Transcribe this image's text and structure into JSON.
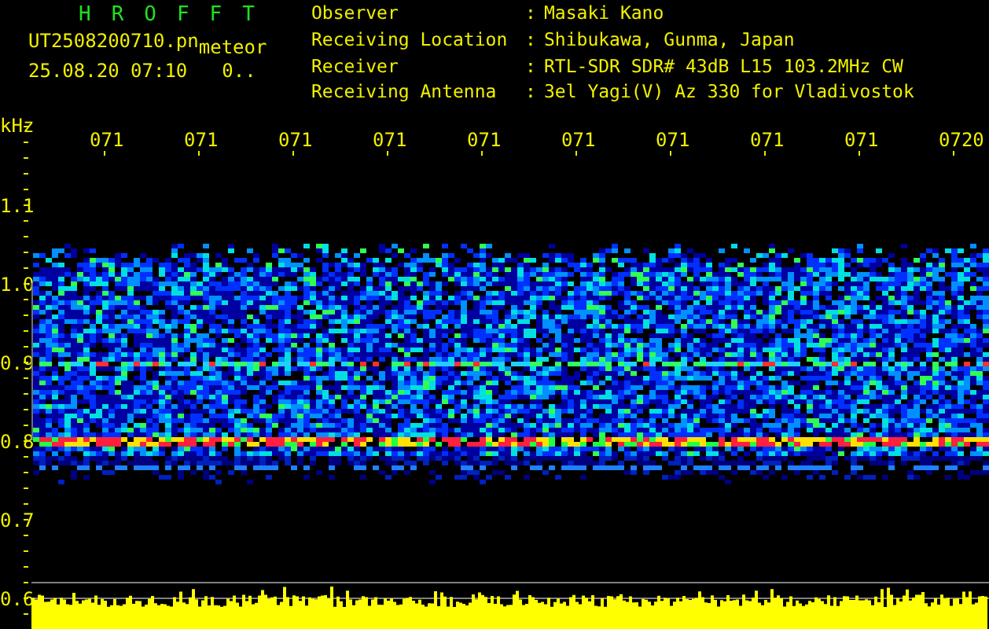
{
  "app_title": "HROFFT",
  "file_name": "UT2508200710.pn",
  "file_suffix": "meteor",
  "timestamp": "25.08.20 07:10",
  "count": "0..",
  "info": [
    {
      "label": "Observer",
      "separator": ":",
      "value": "Masaki Kano"
    },
    {
      "label": "Receiving Location",
      "separator": ":",
      "value": "Shibukawa, Gunma, Japan"
    },
    {
      "label": "Receiver",
      "separator": ":",
      "value": "RTL-SDR SDR# 43dB L15 103.2MHz CW"
    },
    {
      "label": "Receiving Antenna",
      "separator": ":",
      "value": "3el Yagi(V) Az 330 for Vladivostok"
    }
  ],
  "frequency_axis": {
    "unit": "kHz",
    "labels": [
      "1.1",
      "1.0",
      "0.9",
      "0.8",
      "0.7",
      "0.6"
    ]
  },
  "time_labels": [
    "071",
    "071",
    "071",
    "071",
    "071",
    "071",
    "071",
    "071",
    "071",
    "0720"
  ]
}
